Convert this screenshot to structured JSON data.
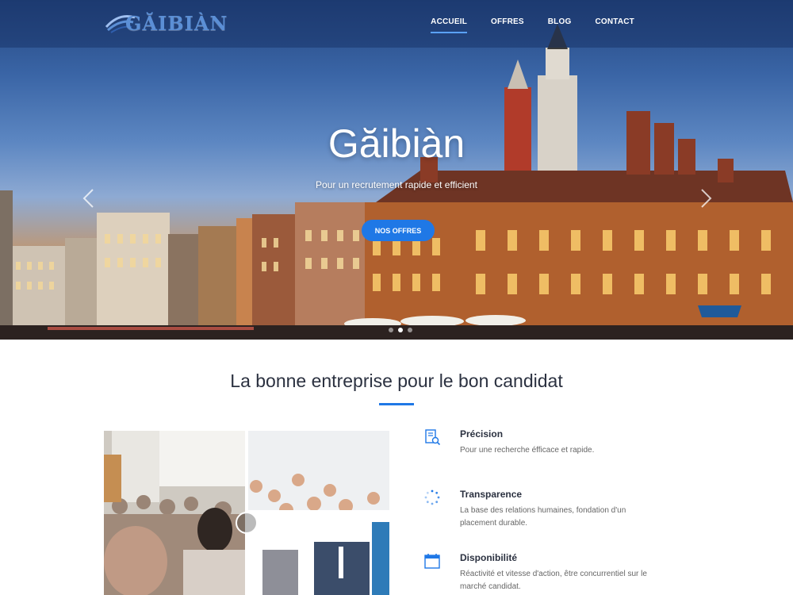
{
  "brand": {
    "logo_text": "GĂIBIÀN"
  },
  "nav": {
    "items": [
      {
        "label": "ACCUEIL",
        "active": true
      },
      {
        "label": "OFFRES",
        "active": false
      },
      {
        "label": "BLOG",
        "active": false
      },
      {
        "label": "CONTACT",
        "active": false
      }
    ]
  },
  "hero": {
    "title": "Găibiàn",
    "subtitle": "Pour un recrutement rapide et efficient",
    "cta_label": "NOS OFFRES",
    "slides_count": 3,
    "active_slide": 2
  },
  "section": {
    "title": "La bonne entreprise pour le bon candidat",
    "accent_color": "#1f78e6"
  },
  "features": [
    {
      "icon": "document-search-icon",
      "title": "Précision",
      "text": "Pour une recherche éfficace et rapide."
    },
    {
      "icon": "spinner-icon",
      "title": "Transparence",
      "text": "La base des relations humaines, fondation d'un placement durable."
    },
    {
      "icon": "calendar-icon",
      "title": "Disponibilité",
      "text": "Réactivité et vitesse d'action, être concurrentiel sur le marché candidat."
    }
  ],
  "colors": {
    "accent": "#1f78e6",
    "heading": "#2b3140",
    "body_text": "#666666",
    "nav_bg": "#142d5f"
  }
}
